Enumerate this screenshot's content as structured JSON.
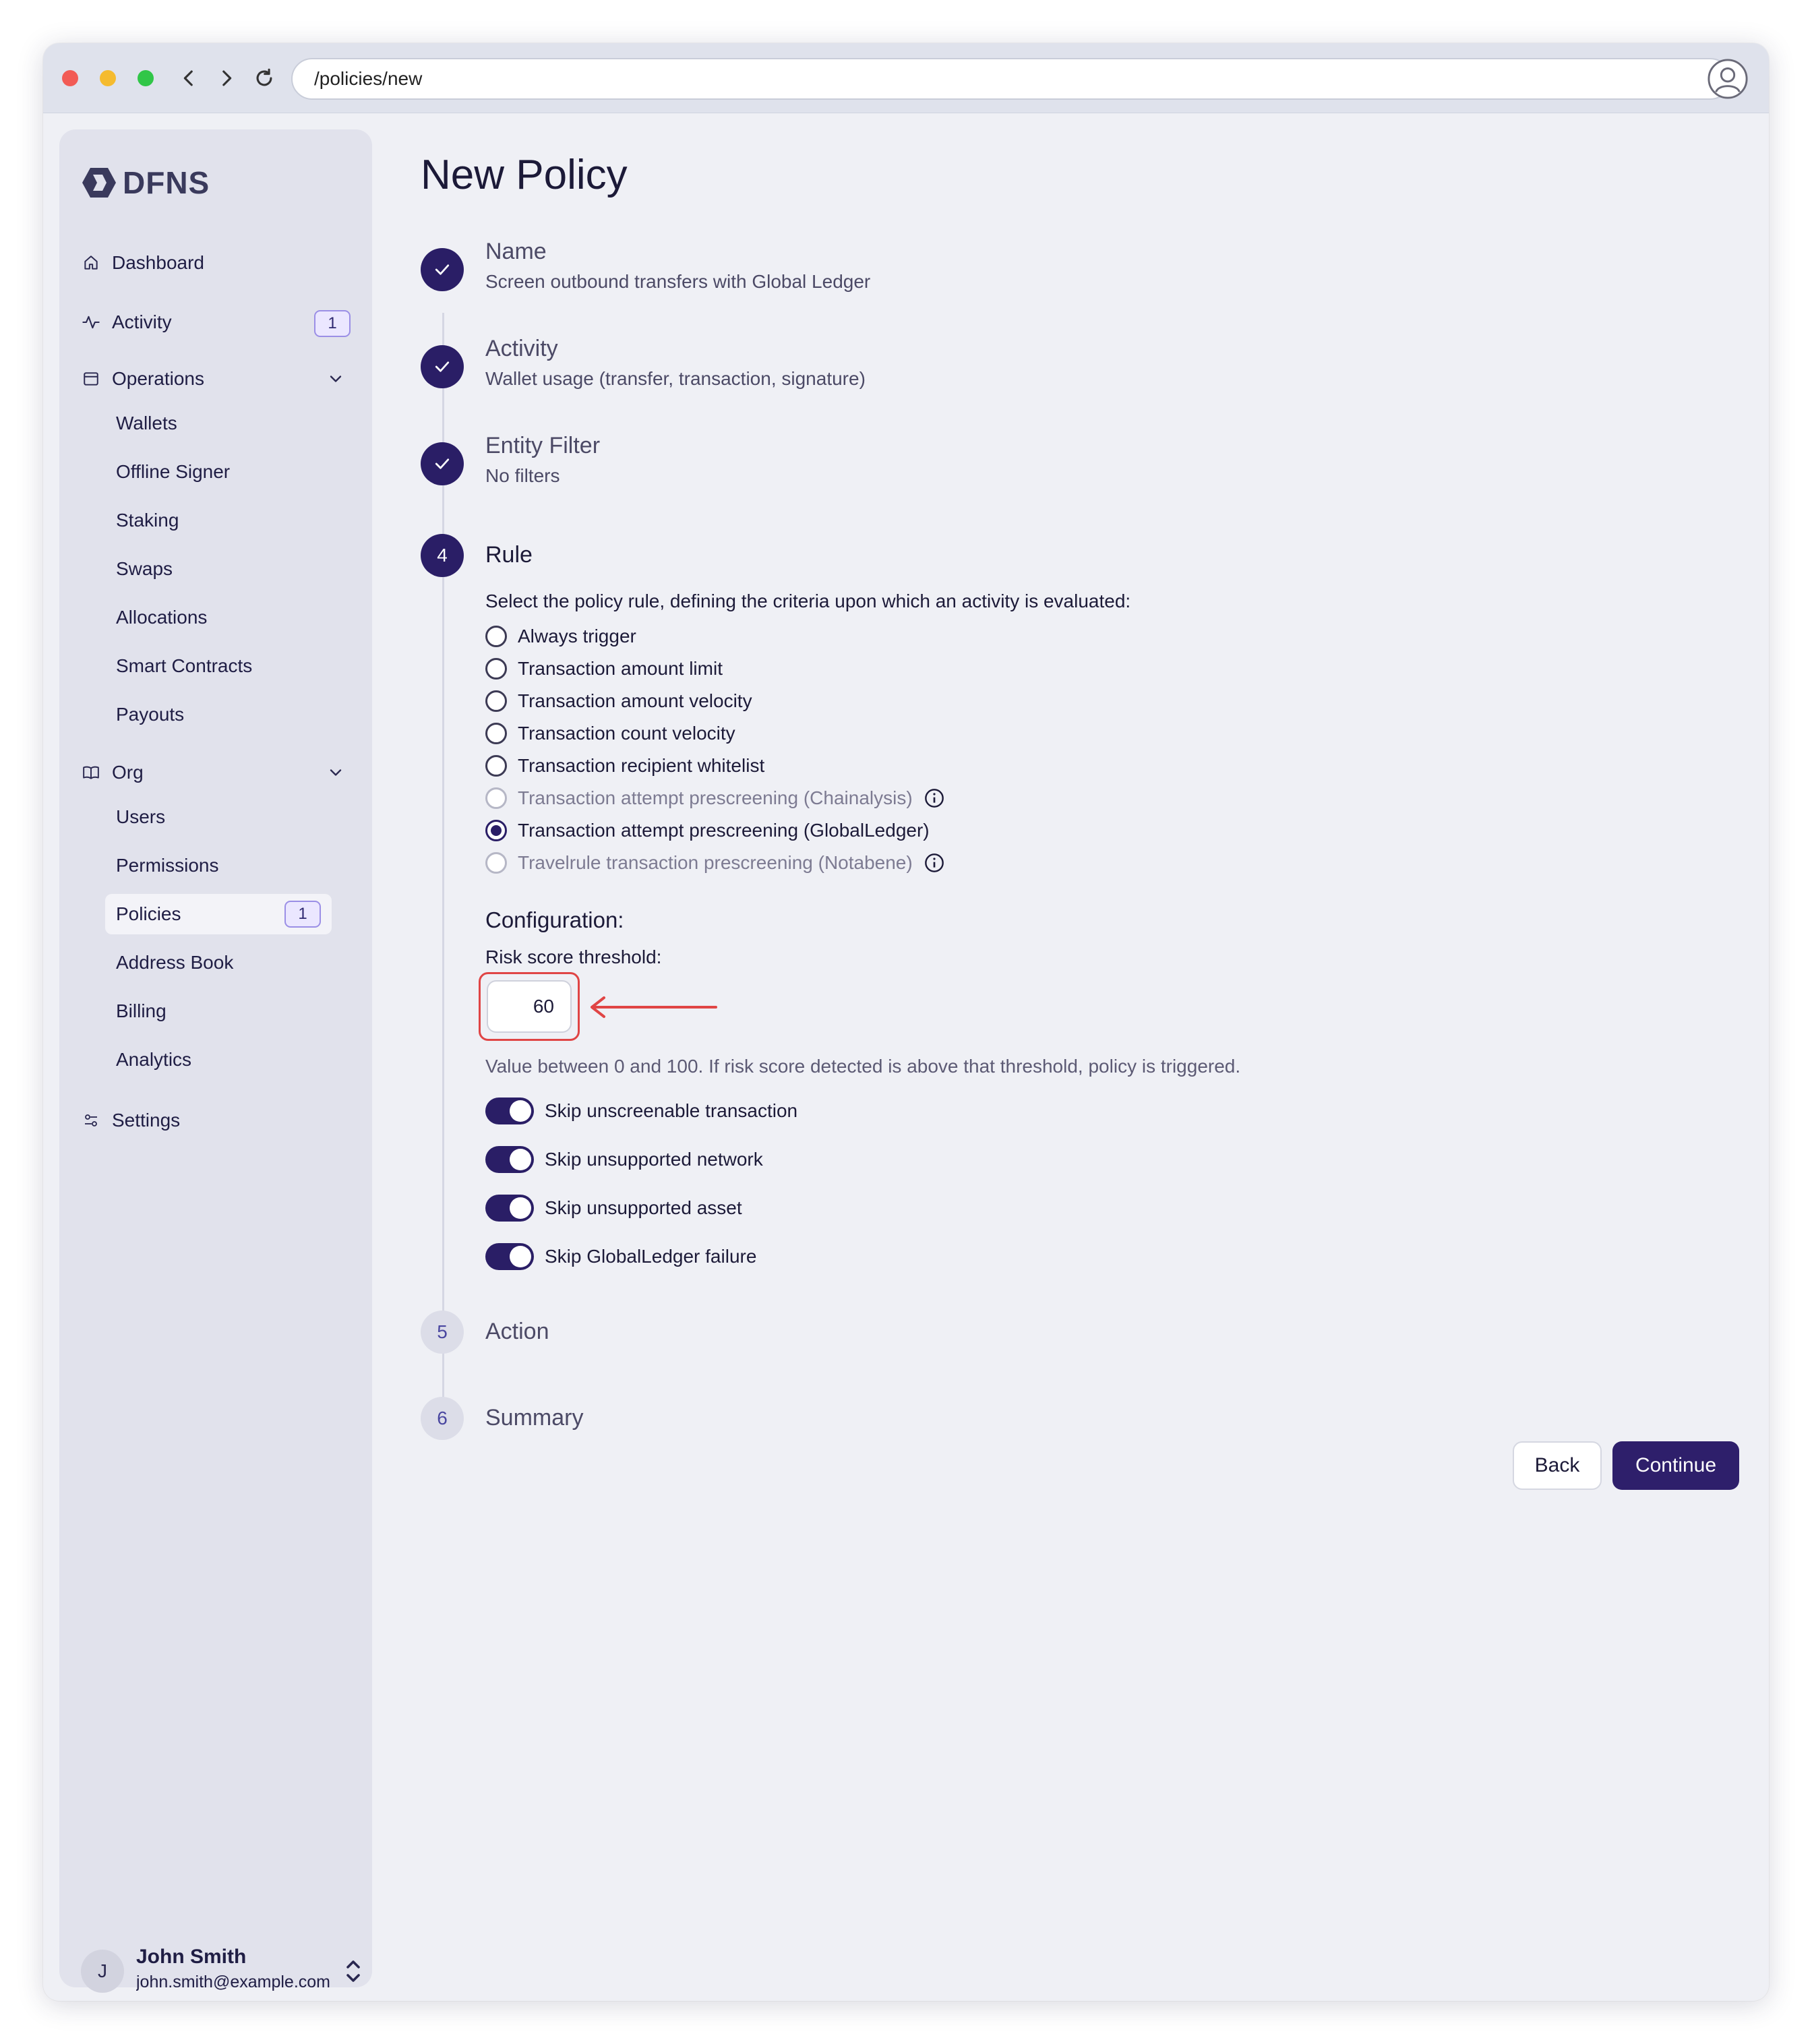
{
  "browser": {
    "url": "/policies/new"
  },
  "sidebar": {
    "brand": "DFNS",
    "items": {
      "dashboard": "Dashboard",
      "activity": "Activity",
      "activity_badge": "1",
      "operations": "Operations",
      "org": "Org",
      "settings": "Settings"
    },
    "operations_items": [
      "Wallets",
      "Offline Signer",
      "Staking",
      "Swaps",
      "Allocations",
      "Smart Contracts",
      "Payouts"
    ],
    "org_items": [
      "Users",
      "Permissions",
      "Policies",
      "Address Book",
      "Billing",
      "Analytics"
    ],
    "policies_badge": "1",
    "active_item": "Policies",
    "user": {
      "initial": "J",
      "name": "John Smith",
      "email": "john.smith@example.com"
    }
  },
  "main": {
    "title": "New Policy",
    "steps": [
      {
        "number": "1",
        "title": "Name",
        "subtitle": "Screen outbound transfers with Global Ledger",
        "state": "done"
      },
      {
        "number": "2",
        "title": "Activity",
        "subtitle": "Wallet usage (transfer, transaction, signature)",
        "state": "done"
      },
      {
        "number": "3",
        "title": "Entity Filter",
        "subtitle": "No filters",
        "state": "done"
      },
      {
        "number": "4",
        "title": "Rule",
        "subtitle": "",
        "state": "current"
      },
      {
        "number": "5",
        "title": "Action",
        "subtitle": "",
        "state": "todo"
      },
      {
        "number": "6",
        "title": "Summary",
        "subtitle": "",
        "state": "todo"
      }
    ],
    "rule": {
      "intro": "Select the policy rule, defining the criteria upon which an activity is evaluated:",
      "options": [
        {
          "label": "Always trigger",
          "disabled": false,
          "checked": false,
          "info": false
        },
        {
          "label": "Transaction amount limit",
          "disabled": false,
          "checked": false,
          "info": false
        },
        {
          "label": "Transaction amount velocity",
          "disabled": false,
          "checked": false,
          "info": false
        },
        {
          "label": "Transaction count velocity",
          "disabled": false,
          "checked": false,
          "info": false
        },
        {
          "label": "Transaction recipient whitelist",
          "disabled": false,
          "checked": false,
          "info": false
        },
        {
          "label": "Transaction attempt prescreening (Chainalysis)",
          "disabled": true,
          "checked": false,
          "info": true
        },
        {
          "label": "Transaction attempt prescreening (GlobalLedger)",
          "disabled": false,
          "checked": true,
          "info": false
        },
        {
          "label": "Travelrule transaction prescreening (Notabene)",
          "disabled": true,
          "checked": false,
          "info": true
        }
      ],
      "config_title": "Configuration:",
      "threshold_label": "Risk score threshold:",
      "threshold_value": "60",
      "helper": "Value between 0 and 100. If risk score detected is above that threshold, policy is triggered.",
      "toggles": [
        {
          "label": "Skip unscreenable transaction",
          "on": true
        },
        {
          "label": "Skip unsupported network",
          "on": true
        },
        {
          "label": "Skip unsupported asset",
          "on": true
        },
        {
          "label": "Skip GlobalLedger failure",
          "on": true
        }
      ]
    },
    "buttons": {
      "back": "Back",
      "continue": "Continue"
    }
  },
  "colors": {
    "accent": "#2a1e66",
    "highlight": "#e04545",
    "badge_border": "#9b8fe6"
  }
}
